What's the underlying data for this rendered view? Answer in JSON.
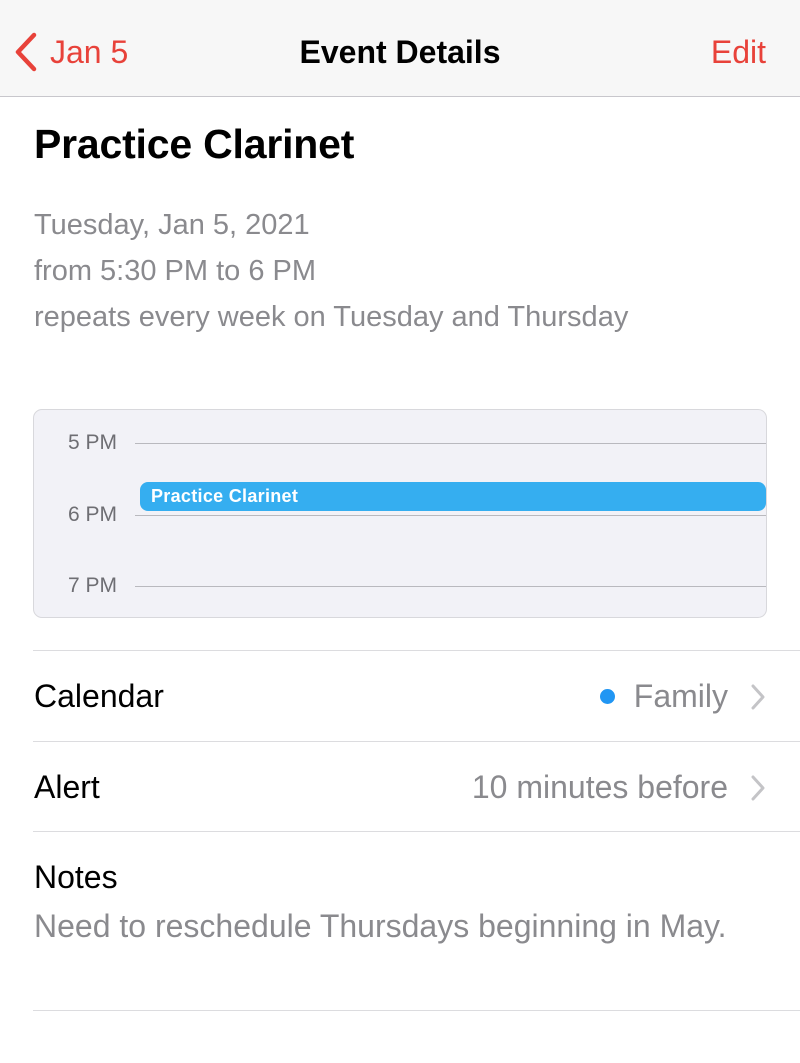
{
  "nav": {
    "back_label": "Jan 5",
    "title": "Event Details",
    "edit_label": "Edit",
    "accent_color": "#e8423a"
  },
  "event": {
    "title": "Practice Clarinet",
    "date": "Tuesday, Jan 5, 2021",
    "time": "from 5:30 PM to 6 PM",
    "repeat": "repeats every week on Tuesday and Thursday"
  },
  "timeline": {
    "hours": [
      "5 PM",
      "6 PM",
      "7 PM"
    ],
    "event_label": "Practice Clarinet",
    "event_color": "#35aef0"
  },
  "details": {
    "calendar_label": "Calendar",
    "calendar_value": "Family",
    "calendar_color": "#2196f3",
    "alert_label": "Alert",
    "alert_value": "10 minutes before",
    "notes_label": "Notes",
    "notes_text": "Need to reschedule Thursdays beginning in May."
  },
  "icons": {
    "back": "chevron-left-icon",
    "disclosure": "chevron-right-icon"
  }
}
